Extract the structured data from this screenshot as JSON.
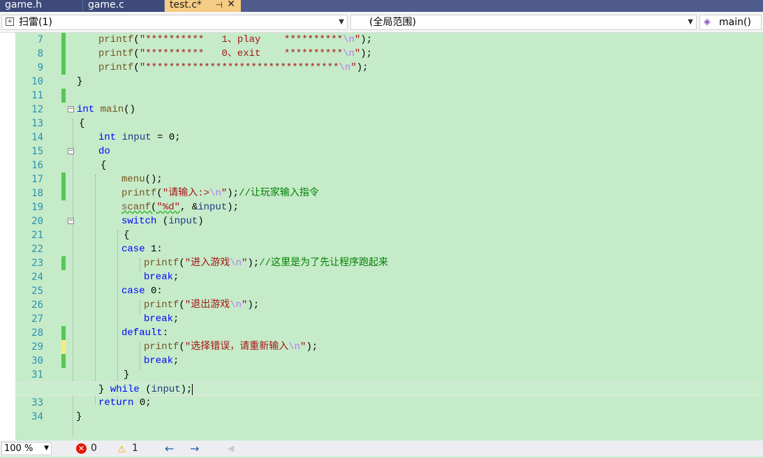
{
  "tabs": [
    {
      "label": "game.h",
      "active": false
    },
    {
      "label": "game.c",
      "active": false
    },
    {
      "label": "test.c*",
      "active": true
    }
  ],
  "tab_pin_glyph": "⊣",
  "tab_close_glyph": "✕",
  "navbar": {
    "project": "扫雷(1)",
    "scope": "(全局范围)",
    "member": "main()"
  },
  "lines": [
    {
      "n": "7",
      "change": "saved"
    },
    {
      "n": "8",
      "change": "saved"
    },
    {
      "n": "9",
      "change": "saved"
    },
    {
      "n": "10",
      "change": ""
    },
    {
      "n": "11",
      "change": "saved"
    },
    {
      "n": "12",
      "change": ""
    },
    {
      "n": "13",
      "change": ""
    },
    {
      "n": "14",
      "change": ""
    },
    {
      "n": "15",
      "change": ""
    },
    {
      "n": "16",
      "change": ""
    },
    {
      "n": "17",
      "change": "saved"
    },
    {
      "n": "18",
      "change": "saved"
    },
    {
      "n": "19",
      "change": ""
    },
    {
      "n": "20",
      "change": ""
    },
    {
      "n": "21",
      "change": ""
    },
    {
      "n": "22",
      "change": ""
    },
    {
      "n": "23",
      "change": "saved"
    },
    {
      "n": "24",
      "change": ""
    },
    {
      "n": "25",
      "change": ""
    },
    {
      "n": "26",
      "change": ""
    },
    {
      "n": "27",
      "change": ""
    },
    {
      "n": "28",
      "change": "saved"
    },
    {
      "n": "29",
      "change": "unsaved"
    },
    {
      "n": "30",
      "change": "saved"
    },
    {
      "n": "31",
      "change": ""
    },
    {
      "n": "32",
      "change": "unsaved"
    },
    {
      "n": "33",
      "change": ""
    },
    {
      "n": "34",
      "change": ""
    }
  ],
  "code": {
    "l7": {
      "fn": "printf",
      "p1": "(",
      "str": "\"**********   1、play    **********",
      "esc": "\\n",
      "str2": "\"",
      "end": ");"
    },
    "l8": {
      "fn": "printf",
      "p1": "(",
      "str": "\"**********   0、exit    **********",
      "esc": "\\n",
      "str2": "\"",
      "end": ");"
    },
    "l9": {
      "fn": "printf",
      "p1": "(",
      "str": "\"*********************************",
      "esc": "\\n",
      "str2": "\"",
      "end": ");"
    },
    "l10": "}",
    "l12": {
      "kw": "int",
      "rest_fn": "main",
      "rest": "()"
    },
    "l13": "{",
    "l14": {
      "kw": "int",
      "var": "input",
      "rest": " = 0;"
    },
    "l15": {
      "kw": "do"
    },
    "l16": "{",
    "l17": {
      "fn": "menu",
      "rest": "();"
    },
    "l18": {
      "fn": "printf",
      "p1": "(",
      "str": "\"请输入:>",
      "esc": "\\n",
      "str2": "\"",
      "mid": ");",
      "cm": "//让玩家输入指令"
    },
    "l19": {
      "fn": "scanf",
      "p1": "(",
      "str": "\"%d\"",
      "mid": ", &",
      "var": "input",
      "end": ");"
    },
    "l20": {
      "kw": "switch",
      "p1": " (",
      "var": "input",
      "end": ")"
    },
    "l21": "{",
    "l22": {
      "kw": "case",
      "rest": " 1:"
    },
    "l23": {
      "fn": "printf",
      "p1": "(",
      "str": "\"进入游戏",
      "esc": "\\n",
      "str2": "\"",
      "mid": ");",
      "cm": "//这里是为了先让程序跑起来"
    },
    "l24": {
      "kw": "break",
      "rest": ";"
    },
    "l25": {
      "kw": "case",
      "rest": " 0:"
    },
    "l26": {
      "fn": "printf",
      "p1": "(",
      "str": "\"退出游戏",
      "esc": "\\n",
      "str2": "\"",
      "end": ");"
    },
    "l27": {
      "kw": "break",
      "rest": ";"
    },
    "l28": {
      "kw": "default",
      "rest": ":"
    },
    "l29": {
      "fn": "printf",
      "p1": "(",
      "str": "\"选择错误，请重新输入",
      "esc": "\\n",
      "str2": "\"",
      "end": ");"
    },
    "l30": {
      "kw": "break",
      "rest": ";"
    },
    "l31": "}",
    "l32": {
      "pre": "} ",
      "kw": "while",
      "p1": " (",
      "var": "input",
      "end": ");"
    },
    "l33": {
      "kw": "return",
      "rest": " 0;"
    },
    "l34": "}"
  },
  "status": {
    "zoom": "100 %",
    "errors": "0",
    "warnings": "1",
    "error_glyph": "✕",
    "warning_glyph": "⚠",
    "back_glyph": "←",
    "forward_glyph": "→",
    "disabled_glyph": "◀"
  },
  "colors": {
    "editor_background": "#c6ebc9",
    "tab_bar": "#4f5b8c",
    "active_tab": "#f5cc84",
    "keyword": "#0000ff",
    "string": "#a31515",
    "comment": "#008000",
    "line_number": "#2b91af",
    "saved_change": "#57c757",
    "unsaved_change": "#f4ee82"
  }
}
